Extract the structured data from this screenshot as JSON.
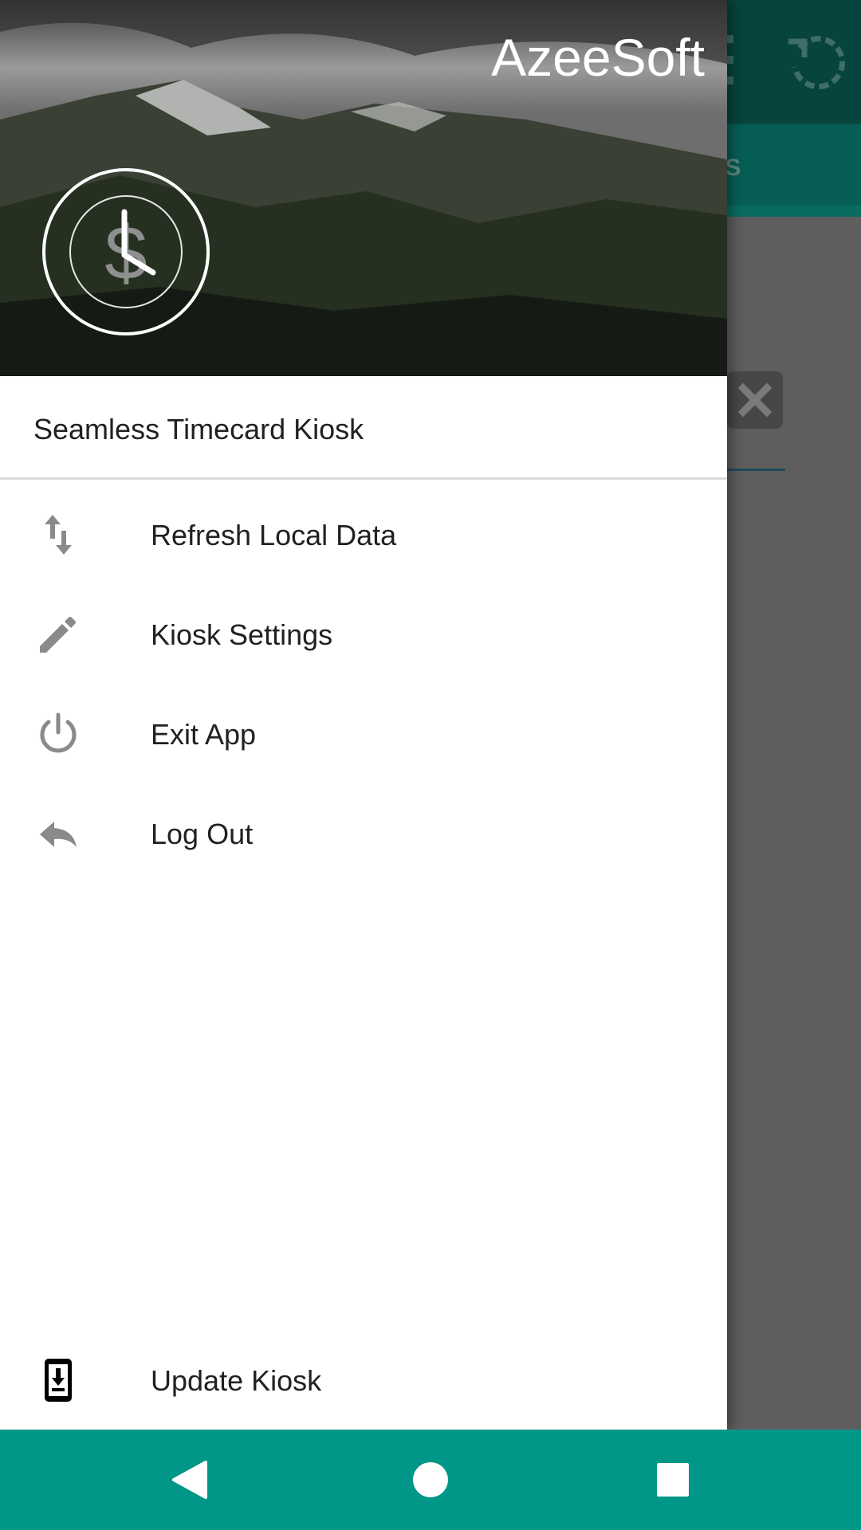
{
  "background_app": {
    "tab_label_partial": "LS"
  },
  "drawer": {
    "header": {
      "title": "AzeeSoft",
      "logo_icon": "clock-dollar-icon"
    },
    "subtitle": "Seamless Timecard Kiosk",
    "menu": [
      {
        "label": "Refresh Local Data",
        "icon": "sync-arrows-icon"
      },
      {
        "label": "Kiosk Settings",
        "icon": "pencil-icon"
      },
      {
        "label": "Exit App",
        "icon": "power-icon"
      },
      {
        "label": "Log Out",
        "icon": "reply-arrow-icon"
      }
    ],
    "footer_item": {
      "label": "Update Kiosk",
      "icon": "phone-download-icon"
    }
  },
  "system_nav": {
    "back_icon": "back-triangle-icon",
    "home_icon": "home-circle-icon",
    "recents_icon": "recents-square-icon"
  },
  "colors": {
    "nav_bar": "#009688",
    "toolbar_dimmed": "#07443d",
    "scrim": "#5e5e5e",
    "menu_icon": "#8a8a8a"
  }
}
